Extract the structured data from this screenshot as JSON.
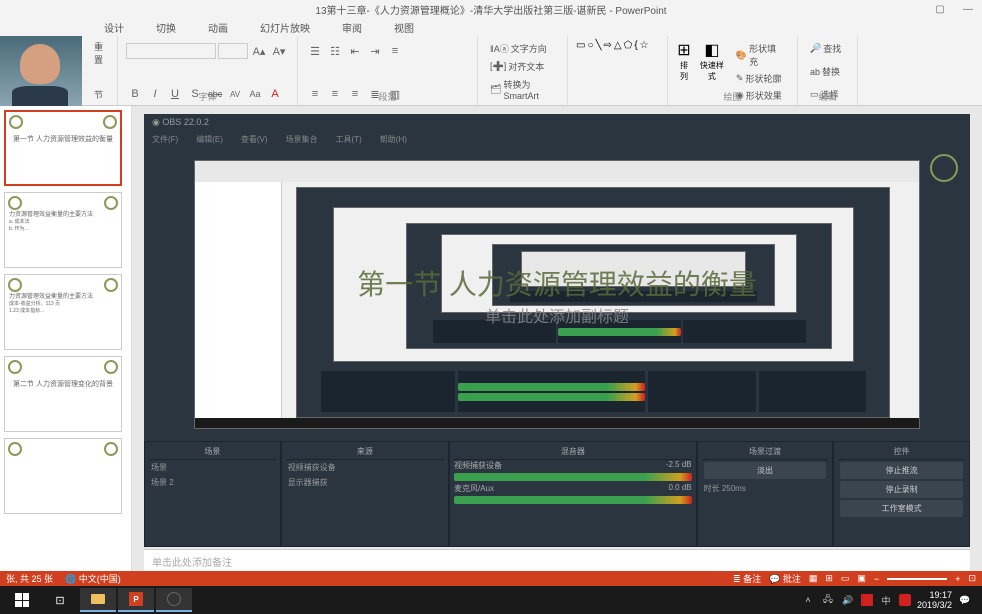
{
  "title": "13第十三章-《人力资源管理概论》-清华大学出版社第三版-谌新民 - PowerPoint",
  "tabs": [
    "设计",
    "切换",
    "动画",
    "幻灯片放映",
    "审阅",
    "视图"
  ],
  "ribbon": {
    "clipboard": {
      "reset": "重置",
      "section": "节"
    },
    "font": {
      "label": "字体",
      "buttons": [
        "B",
        "I",
        "U",
        "S",
        "abc",
        "AV",
        "Aa",
        "A"
      ]
    },
    "paragraph": {
      "label": "段落",
      "textdir": "文字方向",
      "align": "对齐文本",
      "smartart": "转换为 SmartArt"
    },
    "drawing": {
      "label": "绘图",
      "arrange": "排列",
      "quickstyle": "快速样式",
      "fill": "形状填充",
      "outline": "形状轮廓",
      "effects": "形状效果"
    },
    "editing": {
      "label": "编辑",
      "find": "查找",
      "replace": "替换",
      "select": "选择"
    }
  },
  "thumbs": [
    {
      "title": "第一节 人力资源管理效益的衡量"
    },
    {
      "title": "力资源管理效益衡量的主要方法",
      "lines": [
        "a. 成本法",
        "b. 作为..."
      ]
    },
    {
      "title": "力资源管理效益衡量的主要方法",
      "lines": [
        "成本-收益分析。113 页",
        "1.23 成本指标..."
      ]
    },
    {
      "title": "第二节 人力资源管理变化的背景"
    },
    {
      "title": ""
    }
  ],
  "slide": {
    "title": "第一节  人力资源管理效益的衡量",
    "subtitle": "单击此处添加副标题"
  },
  "obs": {
    "menus": [
      "文件(F)",
      "编辑(E)",
      "查看(V)",
      "场景集合",
      "工具(T)",
      "帮助(H)"
    ],
    "panels": {
      "scenes": {
        "title": "场景",
        "items": [
          "场景",
          "场景 2"
        ]
      },
      "sources": {
        "title": "来源",
        "items": [
          "视频捕获设备",
          "显示器捕获"
        ]
      },
      "mixer": {
        "title": "混音器",
        "items": [
          "视频捕获设备",
          "麦克风/Aux"
        ],
        "db": "-2.5 dB"
      },
      "transitions": {
        "title": "场景过渡",
        "items": [
          "淡出",
          "时长 250ms"
        ]
      },
      "controls": {
        "title": "控件",
        "items": [
          "停止推流",
          "停止录制",
          "工作室模式"
        ]
      }
    }
  },
  "notes": "单击此处添加备注",
  "status": {
    "slide": "张, 共 25 张",
    "lang": "中文(中国)",
    "comments": "备注",
    "annotations": "批注"
  },
  "tray": {
    "time": "19:17",
    "date": "2019/3/2"
  }
}
